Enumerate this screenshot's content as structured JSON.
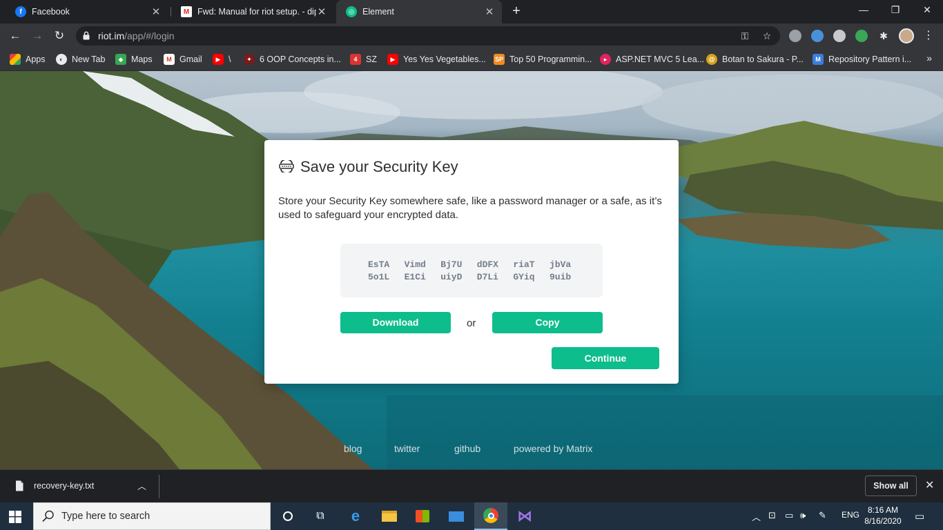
{
  "browser": {
    "tabs": [
      {
        "title": "Facebook",
        "icon": "facebook-icon",
        "color": "#1877f2",
        "active": false
      },
      {
        "title": "Fwd: Manual for riot setup. - dipe",
        "icon": "gmail-icon",
        "color": "#d93025",
        "active": false
      },
      {
        "title": "Element",
        "icon": "element-icon",
        "color": "#0dbd8b",
        "active": true
      }
    ],
    "new_tab": "+",
    "window_controls": {
      "minimize": "—",
      "maximize": "❐",
      "close": "✕"
    },
    "url_host": "riot.im",
    "url_path": "/app/#/login",
    "bookmarks": [
      {
        "label": "Apps",
        "icon": "apps-grid-icon"
      },
      {
        "label": "New Tab",
        "icon": "globe-icon"
      },
      {
        "label": "Maps",
        "icon": "maps-icon"
      },
      {
        "label": "Gmail",
        "icon": "gmail-icon"
      },
      {
        "label": "\\",
        "icon": "youtube-icon"
      },
      {
        "label": "6 OOP Concepts in...",
        "icon": "bookmark-site-icon"
      },
      {
        "label": "SZ",
        "icon": "shield-icon"
      },
      {
        "label": "Yes Yes Vegetables...",
        "icon": "youtube-icon"
      },
      {
        "label": "Top 50 Programmin...",
        "icon": "sp-icon"
      },
      {
        "label": "ASP.NET MVC 5 Lea...",
        "icon": "play-icon"
      },
      {
        "label": "Botan to Sakura - P...",
        "icon": "bookmark-site-icon"
      },
      {
        "label": "Repository Pattern i...",
        "icon": "bookmark-site-icon"
      }
    ],
    "bookmarks_more": "»"
  },
  "dialog": {
    "title": "Save your Security Key",
    "body": "Store your Security Key somewhere safe, like a password manager or a safe, as it’s used to safeguard your encrypted data.",
    "key_words": [
      "EsTA",
      "Vimd",
      "Bj7U",
      "dDFX",
      "riaT",
      "jbVa",
      "5o1L",
      "E1Ci",
      "uiyD",
      "D7Li",
      "GYiq",
      "9uib"
    ],
    "download_label": "Download",
    "or_label": "or",
    "copy_label": "Copy",
    "continue_label": "Continue"
  },
  "footer": {
    "blog": "blog",
    "twitter": "twitter",
    "github": "github",
    "powered": "powered by Matrix"
  },
  "download_shelf": {
    "file_name": "recovery-key.txt",
    "show_all": "Show all"
  },
  "taskbar": {
    "search_placeholder": "Type here to search",
    "language": "ENG",
    "time": "8:16 AM",
    "date": "8/16/2020"
  },
  "colors": {
    "accent": "#0dbd8b",
    "chrome_dark": "#202124",
    "chrome_toolbar": "#35363a"
  }
}
